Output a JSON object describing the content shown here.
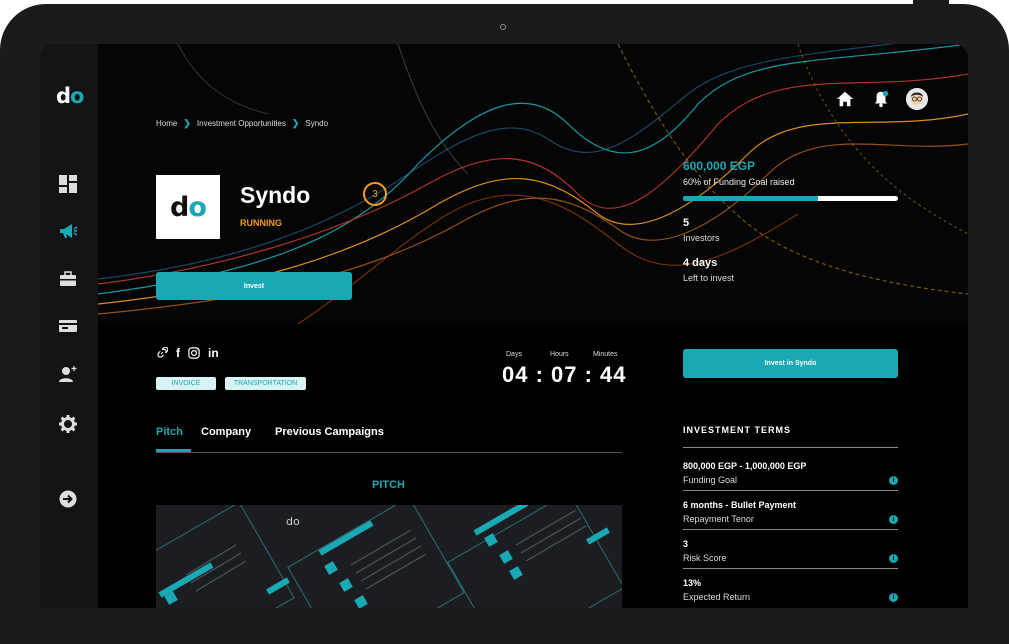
{
  "app": {
    "logo_text": "d",
    "logo_accent": "o",
    "accent_color": "#1aa9b4",
    "warning_color": "#f39c1f"
  },
  "sidebar": {
    "items": [
      {
        "icon": "dashboard-icon"
      },
      {
        "icon": "megaphone-icon",
        "active": true
      },
      {
        "icon": "briefcase-icon"
      },
      {
        "icon": "card-icon"
      },
      {
        "icon": "add-user-icon"
      },
      {
        "icon": "gear-icon"
      },
      {
        "icon": "logout-icon"
      }
    ]
  },
  "breadcrumb": [
    "Home",
    "Investment Opportunities",
    "Syndo"
  ],
  "header_icons": [
    "home-icon",
    "bell-icon",
    "avatar"
  ],
  "company": {
    "logo_text": "d",
    "logo_accent": "o",
    "name": "Syndo",
    "status": "RUNNING",
    "risk_score": "3",
    "invest_label": "Invest"
  },
  "funding": {
    "raised": "600,000 EGP",
    "raised_caption": "60% of Funding Goal raised",
    "progress_fraction": 0.63,
    "investors_value": "5",
    "investors_label": "Investors",
    "time_left_value": "4 days",
    "time_left_label": "Left to invest"
  },
  "social": {
    "link": "link-icon",
    "facebook": "f",
    "instagram": "instagram-icon",
    "linkedin": "in"
  },
  "tags": [
    "INVOICE",
    "TRANSPORTATION"
  ],
  "countdown": {
    "labels": [
      "Days",
      "Hours",
      "Minutes"
    ],
    "value": "04 : 07 : 44"
  },
  "tabs": [
    "Pitch",
    "Company",
    "Previous Campaigns"
  ],
  "pitch": {
    "title": "PITCH"
  },
  "invest_cta": "Invest in Syndo",
  "terms": {
    "title": "INVESTMENT TERMS",
    "items": [
      {
        "value": "800,000 EGP - 1,000,000 EGP",
        "label": "Funding Goal"
      },
      {
        "value": "6 months - Bullet Payment",
        "label": "Repayment Tenor"
      },
      {
        "value": "3",
        "label": "Risk Score"
      },
      {
        "value": "13%",
        "label": "Expected Return"
      }
    ]
  }
}
